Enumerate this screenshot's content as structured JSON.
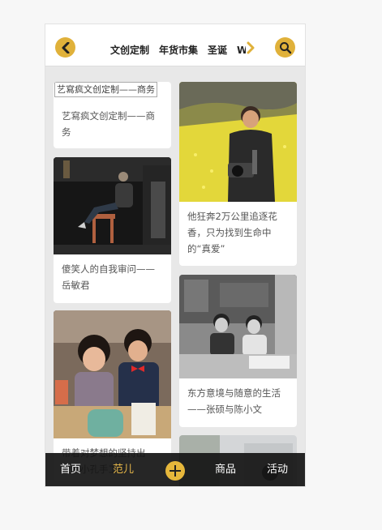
{
  "header": {
    "tabs": [
      "文创定制",
      "年货市集",
      "圣诞",
      "W"
    ]
  },
  "cards": [
    {
      "alt": "艺寫疯文创定制——商务",
      "title": "艺寫疯文创定制——商务"
    },
    {
      "title": "他狂奔2万公里追逐花香，只为找到生命中的“真爱”"
    },
    {
      "title": "傻笑人的自我审问——岳敏君"
    },
    {
      "title": "东方意境与随意的生活——张硕与陈小文"
    },
    {
      "title": "带着对梦想的坚持出发，小孔手工的"
    }
  ],
  "bottom_nav": {
    "home": "首页",
    "fan": "范儿",
    "goods": "商品",
    "events": "活动"
  },
  "colors": {
    "accent": "#e0b13a",
    "active_tab": "#e8b84a",
    "bar": "#141414"
  }
}
